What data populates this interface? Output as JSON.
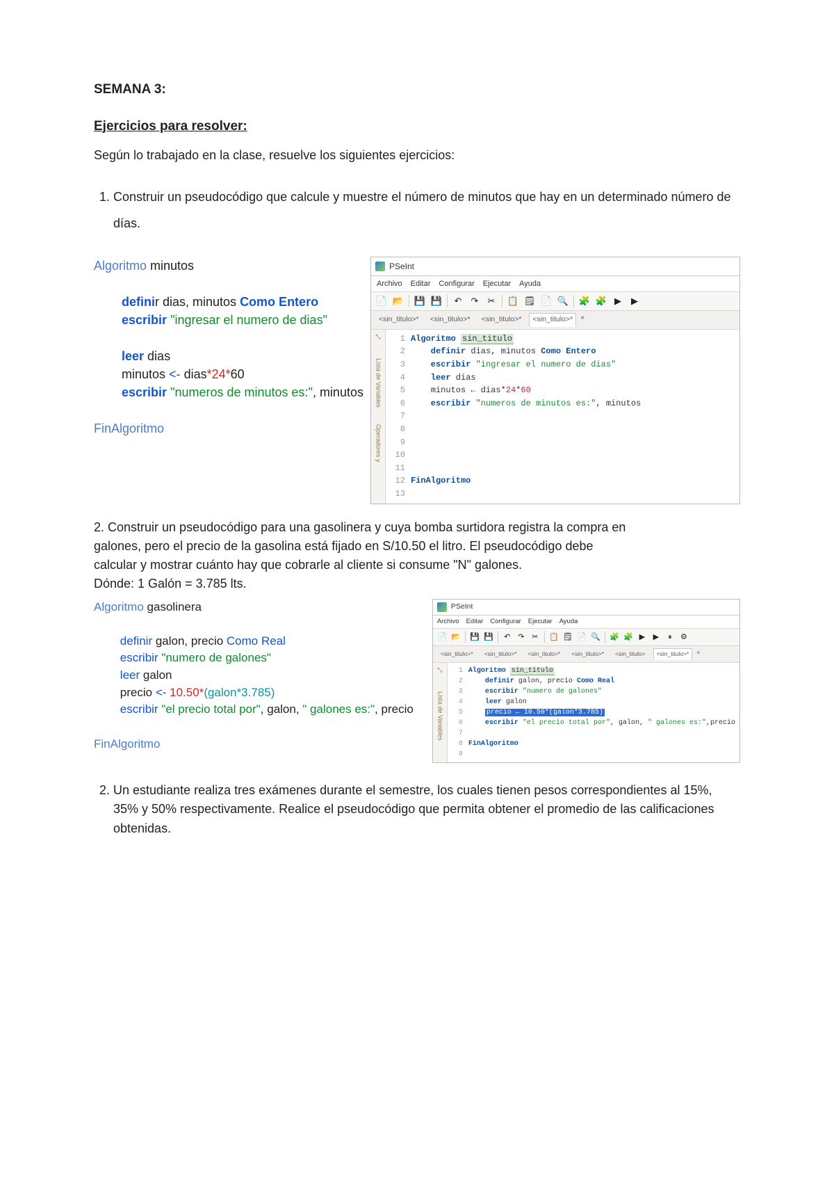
{
  "heading": "SEMANA 3:",
  "subheading": "Ejercicios para resolver:",
  "intro": "Según lo trabajado en la clase, resuelve los siguientes ejercicios:",
  "ex1": {
    "num": "1.",
    "text": "Construir un pseudocódigo que calcule y muestre el número de minutos que hay en un determinado número de días."
  },
  "pseudo1": {
    "l1a": "Algoritmo",
    "l1b": " minutos",
    "l2a": "defini",
    "l2b": "r dias, minutos ",
    "l2c": "Como Entero",
    "l3a": "escribir ",
    "l3b": "\"ingresar el numero de dias\"",
    "l4a": "leer",
    "l4b": " dias",
    "l5a": "minutos ",
    "l5b": "<-",
    "l5c": " dias",
    "l5d": "*24*",
    "l5e": "60",
    "l6a": "escribir ",
    "l6b": "\"numeros de minutos es:\"",
    "l6c": ", minutos",
    "l7": "FinAlgoritmo"
  },
  "pseint": {
    "title": "PSeInt",
    "menu": [
      "Archivo",
      "Editar",
      "Configurar",
      "Ejecutar",
      "Ayuda"
    ],
    "tabs": [
      "<sin_titulo>*",
      "<sin_titulo>*",
      "<sin_titulo>*",
      "<sin_titulo>*"
    ],
    "close": "×",
    "gutter": [
      "Lista de Variables",
      "Operadores y"
    ]
  },
  "editor1": {
    "lines": [
      {
        "n": "1",
        "seg": [
          {
            "c": "ed-alg",
            "t": "Algoritmo "
          },
          {
            "c": "ed-name",
            "t": "sin_titulo"
          }
        ]
      },
      {
        "n": "2",
        "seg": [
          {
            "c": "",
            "t": "    "
          },
          {
            "c": "ed-kw",
            "t": "definir"
          },
          {
            "c": "ed-id",
            "t": " dias, minutos "
          },
          {
            "c": "ed-kw",
            "t": "Como Entero"
          }
        ]
      },
      {
        "n": "3",
        "seg": [
          {
            "c": "",
            "t": "    "
          },
          {
            "c": "ed-kw",
            "t": "escribir "
          },
          {
            "c": "ed-str",
            "t": "\"ingresar el numero de dias\""
          }
        ]
      },
      {
        "n": "4",
        "seg": [
          {
            "c": "",
            "t": "    "
          },
          {
            "c": "ed-kw",
            "t": "leer"
          },
          {
            "c": "ed-id",
            "t": " dias"
          }
        ]
      },
      {
        "n": "5",
        "seg": [
          {
            "c": "ed-id",
            "t": "    minutos ← dias*"
          },
          {
            "c": "ed-num",
            "t": "24"
          },
          {
            "c": "ed-id",
            "t": "*"
          },
          {
            "c": "ed-num",
            "t": "60"
          }
        ]
      },
      {
        "n": "6",
        "seg": [
          {
            "c": "",
            "t": "    "
          },
          {
            "c": "ed-kw",
            "t": "escribir "
          },
          {
            "c": "ed-str",
            "t": "\"numeros de minutos es:\""
          },
          {
            "c": "ed-id",
            "t": ", minutos"
          }
        ]
      },
      {
        "n": "7",
        "seg": []
      },
      {
        "n": "8",
        "seg": []
      },
      {
        "n": "9",
        "seg": []
      },
      {
        "n": "10",
        "seg": []
      },
      {
        "n": "11",
        "seg": []
      },
      {
        "n": "12",
        "seg": [
          {
            "c": "ed-alg",
            "t": "FinAlgoritmo"
          }
        ]
      },
      {
        "n": "13",
        "seg": []
      }
    ]
  },
  "ex2text": {
    "p1": "2. Construir un pseudocódigo para una gasolinera y cuya bomba surtidora registra la compra en",
    "p2": "galones, pero el precio de la gasolina está fijado en S/10.50 el litro. El pseudocódigo debe",
    "p3": "calcular y mostrar cuánto hay que cobrarle al cliente si consume \"N\" galones.",
    "p4": "Dónde: 1 Galón = 3.785 lts."
  },
  "pseudo2": {
    "l1a": "Algoritmo",
    "l1b": " gasolinera",
    "l2a": "definir",
    "l2b": " galon, precio ",
    "l2c": "Como Real",
    "l3a": "escribir ",
    "l3b": "\"numero de galones\"",
    "l4a": "leer",
    "l4b": " galon",
    "l5a": "precio ",
    "l5b": "<-",
    "l5c": " 10.50*",
    "l5d": "(galon*3.785)",
    "l6a": "escribir ",
    "l6b": "\"el precio total por\"",
    "l6c": ", galon, ",
    "l6d": "\" galones es:\"",
    "l6e": ", precio",
    "l7": "FinAlgoritmo"
  },
  "pseint2": {
    "tabs": [
      "<sin_titulo>*",
      "<sin_titulo>*",
      "<sin_titulo>*",
      "<sin_titulo>*",
      "<sin_titulo>",
      "<sin_titulo>*"
    ]
  },
  "editor2": {
    "lines": [
      {
        "n": "1",
        "seg": [
          {
            "c": "ed-alg",
            "t": "Algoritmo "
          },
          {
            "c": "ed-name",
            "t": "sin_titulo"
          }
        ]
      },
      {
        "n": "2",
        "seg": [
          {
            "c": "",
            "t": "    "
          },
          {
            "c": "ed-kw",
            "t": "definir"
          },
          {
            "c": "ed-id",
            "t": " galon, precio "
          },
          {
            "c": "ed-kw",
            "t": "Como Real"
          }
        ]
      },
      {
        "n": "3",
        "seg": [
          {
            "c": "",
            "t": "    "
          },
          {
            "c": "ed-kw",
            "t": "escribir "
          },
          {
            "c": "ed-str",
            "t": "\"numero de galones\""
          }
        ]
      },
      {
        "n": "4",
        "seg": [
          {
            "c": "",
            "t": "    "
          },
          {
            "c": "ed-kw",
            "t": "leer"
          },
          {
            "c": "ed-id",
            "t": " galon"
          }
        ]
      },
      {
        "n": "5",
        "seg": [
          {
            "c": "",
            "t": "    "
          },
          {
            "c": "ed-sel",
            "t": "precio ← 10.50*(galon*3.785)"
          }
        ]
      },
      {
        "n": "6",
        "seg": [
          {
            "c": "",
            "t": "    "
          },
          {
            "c": "ed-kw",
            "t": "escribir "
          },
          {
            "c": "ed-str",
            "t": "\"el precio total por\""
          },
          {
            "c": "ed-id",
            "t": ", galon, "
          },
          {
            "c": "ed-str",
            "t": "\" galones es:\""
          },
          {
            "c": "ed-id",
            "t": ",precio"
          }
        ]
      },
      {
        "n": "7",
        "seg": []
      },
      {
        "n": "8",
        "seg": [
          {
            "c": "ed-alg",
            "t": "FinAlgoritmo"
          }
        ]
      },
      {
        "n": "9",
        "seg": []
      }
    ]
  },
  "ex3": {
    "num": "2.",
    "text": "Un estudiante realiza tres exámenes durante el semestre, los cuales tienen pesos correspondientes al 15%, 35% y 50% respectivamente. Realice el pseudocódigo que permita obtener el promedio de las calificaciones obtenidas."
  },
  "toolbar_icons": [
    "📄",
    "📂",
    "💾",
    "💾",
    "↶",
    "↷",
    "✂",
    "📋",
    "🗒",
    "📄",
    "🔍",
    "🧩",
    "🧩",
    "▶",
    "▶"
  ],
  "toolbar_icons2": [
    "📄",
    "📂",
    "💾",
    "💾",
    "↶",
    "↷",
    "✂",
    "📋",
    "🗒",
    "📄",
    "🔍",
    "🧩",
    "🧩",
    "▶",
    "▶",
    "⏸",
    "⚙"
  ]
}
